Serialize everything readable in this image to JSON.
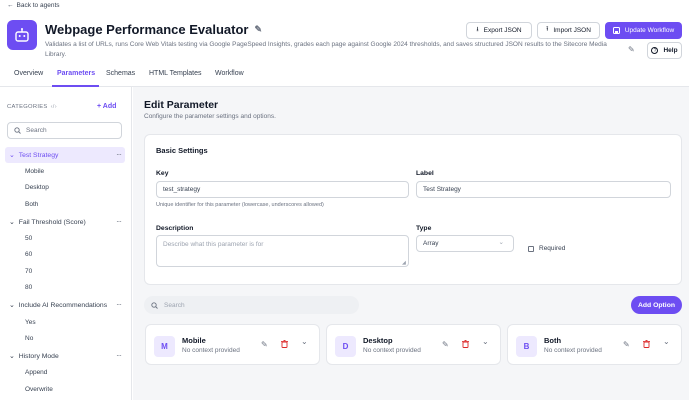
{
  "header": {
    "back_label": "Back to agents",
    "title": "Webpage Performance Evaluator",
    "description": "Validates a list of URLs, runs Core Web Vitals testing via Google PageSpeed Insights, grades each page against Google 2024 thresholds, and saves structured JSON results to the Sitecore Media Library.",
    "export_label": "Export JSON",
    "import_label": "Import JSON",
    "update_label": "Update Workflow",
    "help_label": "Help"
  },
  "tabs": [
    "Overview",
    "Parameters",
    "Schemas",
    "HTML Templates",
    "Workflow"
  ],
  "active_tab": "Parameters",
  "sidebar": {
    "heading": "CATEGORIES",
    "add_label": "+ Add",
    "search_placeholder": "Search",
    "categories": [
      {
        "label": "Test Strategy",
        "options": [
          "Mobile",
          "Desktop",
          "Both"
        ]
      },
      {
        "label": "Fail Threshold (Score)",
        "options": [
          "50",
          "60",
          "70",
          "80"
        ]
      },
      {
        "label": "Include AI Recommendations",
        "options": [
          "Yes",
          "No"
        ]
      },
      {
        "label": "History Mode",
        "options": [
          "Append",
          "Overwrite"
        ]
      }
    ]
  },
  "editor": {
    "heading": "Edit Parameter",
    "subheading": "Configure the parameter settings and options.",
    "basic_settings": "Basic Settings",
    "key_label": "Key",
    "key_value": "test_strategy",
    "key_hint": "Unique identifier for this parameter (lowercase, underscores allowed)",
    "label_label": "Label",
    "label_value": "Test Strategy",
    "description_label": "Description",
    "description_placeholder": "Describe what this parameter is for",
    "type_label": "Type",
    "type_value": "Array",
    "required_label": "Required",
    "required_checked": false,
    "options_search_placeholder": "Search",
    "add_option_label": "Add Option"
  },
  "options": [
    {
      "initial": "M",
      "name": "Mobile",
      "context": "No context provided"
    },
    {
      "initial": "D",
      "name": "Desktop",
      "context": "No context provided"
    },
    {
      "initial": "B",
      "name": "Both",
      "context": "No context provided"
    }
  ],
  "colors": {
    "accent": "#6d4df2",
    "delete": "#dc2626",
    "selected_bg": "#ede9fe"
  }
}
